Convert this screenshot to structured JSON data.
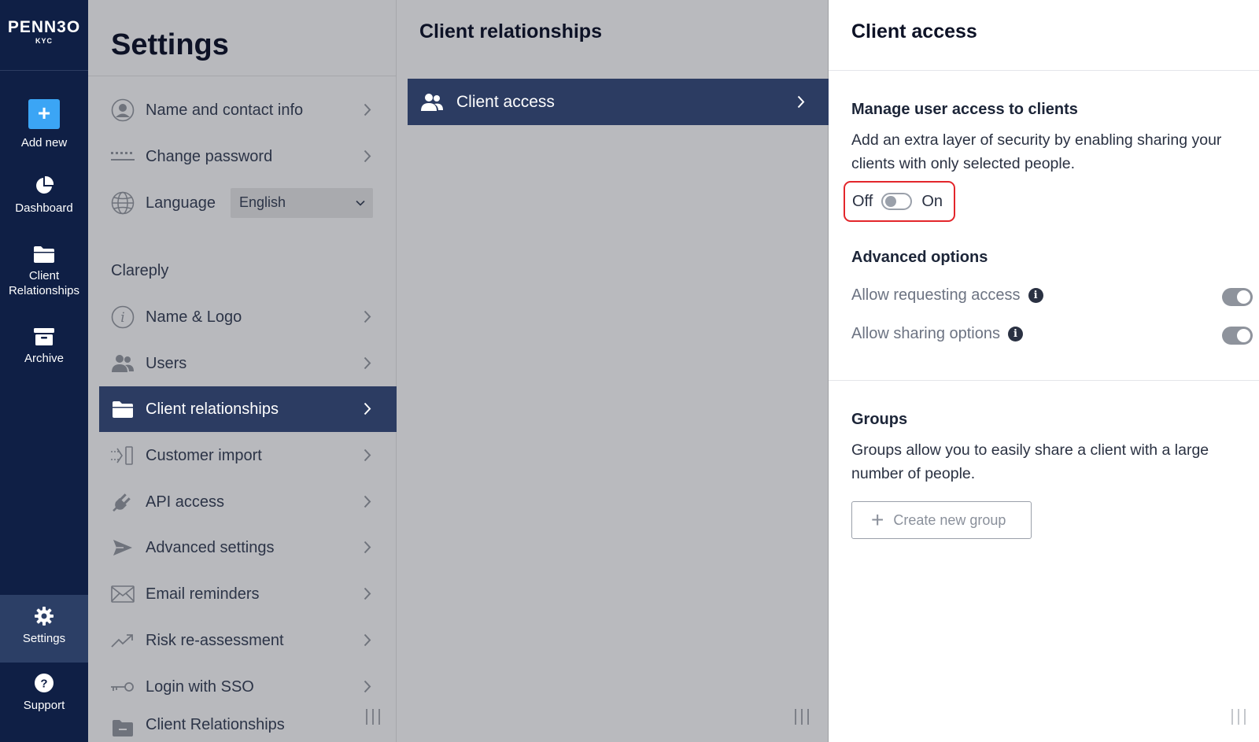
{
  "rail": {
    "logo_brand": "PENN3O",
    "logo_sub": "KYC",
    "items": [
      {
        "label": "Add new",
        "icon": "plus-icon"
      },
      {
        "label": "Dashboard",
        "icon": "pie-chart-icon"
      },
      {
        "label": "Client\nRelationships",
        "icon": "folder-icon"
      },
      {
        "label": "Archive",
        "icon": "archive-box-icon"
      },
      {
        "label": "Settings",
        "icon": "gear-icon"
      },
      {
        "label": "Support",
        "icon": "question-icon"
      }
    ]
  },
  "settings": {
    "title": "Settings",
    "items": [
      {
        "label": "Name and contact info",
        "icon": "user-circle-icon"
      },
      {
        "label": "Change password",
        "icon": "password-dots-icon"
      },
      {
        "label": "Language",
        "icon": "globe-icon"
      },
      {
        "label": "Name & Logo",
        "icon": "info-circle-icon"
      },
      {
        "label": "Users",
        "icon": "users-icon"
      },
      {
        "label": "Client relationships",
        "icon": "folder-icon"
      },
      {
        "label": "Customer import",
        "icon": "import-icon"
      },
      {
        "label": "API access",
        "icon": "plug-icon"
      },
      {
        "label": "Advanced settings",
        "icon": "paper-plane-icon"
      },
      {
        "label": "Email reminders",
        "icon": "envelope-icon"
      },
      {
        "label": "Risk re-assessment",
        "icon": "trend-up-icon"
      },
      {
        "label": "Login with SSO",
        "icon": "key-icon"
      },
      {
        "label": "Client Relationships",
        "icon": "folder-icon"
      }
    ],
    "language_value": "English",
    "section_label": "Clareply"
  },
  "middle": {
    "title": "Client relationships",
    "row_label": "Client access"
  },
  "panel": {
    "title": "Client access",
    "manage_heading": "Manage user access to clients",
    "manage_text": "Add an extra layer of security by enabling sharing your clients with only selected people.",
    "toggle_off": "Off",
    "toggle_on": "On",
    "advanced_heading": "Advanced options",
    "opt_requesting": "Allow requesting access",
    "opt_sharing": "Allow sharing options",
    "groups_heading": "Groups",
    "groups_text": "Groups allow you to easily share a client with a large number of people.",
    "create_group": "Create new group"
  },
  "colors": {
    "rail_bg": "#0f1f45",
    "active_row": "#2c3c62",
    "add_button": "#3ba5f5",
    "highlight": "#e3262b"
  }
}
